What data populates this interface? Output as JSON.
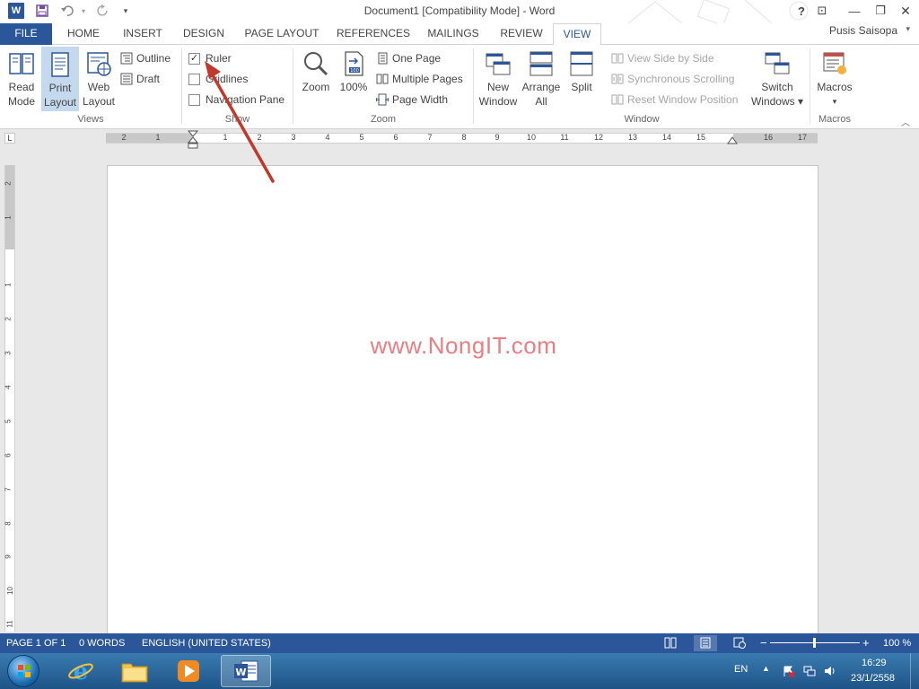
{
  "window": {
    "title": "Document1 [Compatibility Mode] - Word",
    "help": "?",
    "restore_ribbon": "⊡",
    "minimize": "—",
    "maximize": "❐",
    "close": "✕"
  },
  "qat": {
    "word_letter": "W",
    "dropdown": "▾"
  },
  "tabs": {
    "file": "FILE",
    "items": [
      "HOME",
      "INSERT",
      "DESIGN",
      "PAGE LAYOUT",
      "REFERENCES",
      "MAILINGS",
      "REVIEW",
      "VIEW"
    ],
    "active": "VIEW",
    "user": "Pusis Saisopa"
  },
  "ribbon": {
    "views": {
      "label": "Views",
      "read_mode": [
        "Read",
        "Mode"
      ],
      "print_layout": [
        "Print",
        "Layout"
      ],
      "web_layout": [
        "Web",
        "Layout"
      ],
      "outline": "Outline",
      "draft": "Draft"
    },
    "show": {
      "label": "Show",
      "ruler": "Ruler",
      "ruler_checked": true,
      "gridlines": "Gridlines",
      "gridlines_checked": false,
      "navigation_pane": "Navigation Pane",
      "navigation_pane_checked": false
    },
    "zoom": {
      "label": "Zoom",
      "zoom": "Zoom",
      "hundred": "100%",
      "one_page": "One Page",
      "multiple_pages": "Multiple Pages",
      "page_width": "Page Width"
    },
    "window": {
      "label": "Window",
      "new_window": [
        "New",
        "Window"
      ],
      "arrange_all": [
        "Arrange",
        "All"
      ],
      "split": "Split",
      "view_side_by_side": "View Side by Side",
      "synchronous_scrolling": "Synchronous Scrolling",
      "reset_window_position": "Reset Window Position",
      "switch_windows": [
        "Switch",
        "Windows ▾"
      ]
    },
    "macros": {
      "label": "Macros",
      "macros": "Macros",
      "caret": "▾"
    }
  },
  "ruler": {
    "corner": "L",
    "h_ticks": [
      "2",
      "1",
      "1",
      "2",
      "3",
      "4",
      "5",
      "6",
      "7",
      "8",
      "9",
      "10",
      "11",
      "12",
      "13",
      "14",
      "15",
      "16",
      "17",
      "18"
    ],
    "v_ticks": [
      "2",
      "1",
      "1",
      "2",
      "3",
      "4",
      "5",
      "6",
      "7",
      "8",
      "9",
      "10",
      "11"
    ]
  },
  "document": {
    "watermark": "www.NongIT.com"
  },
  "statusbar": {
    "page": "PAGE 1 OF 1",
    "words": "0 WORDS",
    "language": "ENGLISH (UNITED STATES)",
    "zoom_minus": "−",
    "zoom_plus": "+",
    "zoom_level": "100 %"
  },
  "taskbar": {
    "lang": "EN",
    "time": "16:29",
    "date": "23/1/2558"
  },
  "colors": {
    "accent": "#2b579a",
    "watermark": "#ee7d82",
    "arrow": "#c0392b"
  }
}
